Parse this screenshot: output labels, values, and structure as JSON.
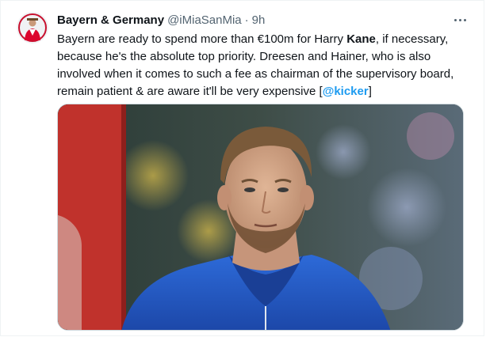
{
  "tweet": {
    "author_name": "Bayern & Germany",
    "handle": "@iMiaSanMia",
    "separator": "·",
    "time": "9h",
    "text_1": "Bayern are ready to spend more than €100m for Harry ",
    "text_bold": "Kane",
    "text_2": ", if necessary, because he's the absolute top priority. Dreesen and Hainer, who is also involved when it comes to such a fee as chairman of the supervisory board, remain patient & are aware it'll be very expensive [",
    "mention": "@kicker",
    "text_3": "]"
  },
  "icons": {
    "more": "more-horizontal-icon",
    "avatar": "profile-avatar"
  },
  "colors": {
    "link": "#1d9bf0",
    "secondary_text": "#536471",
    "border": "#cfd9de"
  }
}
